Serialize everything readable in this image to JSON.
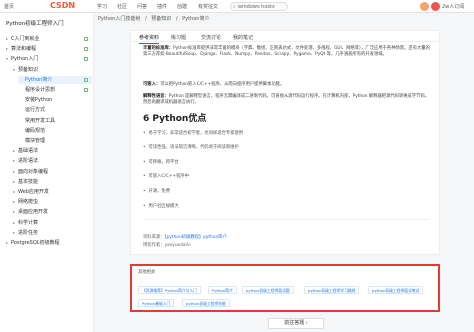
{
  "topbar": {
    "left_link": "首页",
    "logo": "CSDN",
    "nav": [
      "学习",
      "社区",
      "问答",
      "插件",
      "创建",
      "有奖征文"
    ],
    "search_text": "windows hosts",
    "user_label": "2w人订阅"
  },
  "sidebar": {
    "title": "Python初级工程师入门",
    "items": [
      {
        "label": "C入门到就业",
        "level": 0,
        "arrow": "▸",
        "editable": true
      },
      {
        "label": "算法和编程",
        "level": 0,
        "arrow": "▸",
        "editable": true
      },
      {
        "label": "Python入门",
        "level": 0,
        "arrow": "▾",
        "editable": true
      },
      {
        "label": "预备知识",
        "level": 1,
        "arrow": "▾",
        "editable": false
      },
      {
        "label": "Python简介",
        "level": 2,
        "arrow": "",
        "editable": true,
        "active": true
      },
      {
        "label": "程序设计思想",
        "level": 2,
        "arrow": "",
        "editable": true
      },
      {
        "label": "安装Python",
        "level": 2,
        "arrow": "",
        "editable": false
      },
      {
        "label": "运行方式",
        "level": 2,
        "arrow": "",
        "editable": false
      },
      {
        "label": "常用开发工具",
        "level": 2,
        "arrow": "",
        "editable": false
      },
      {
        "label": "编码规范",
        "level": 2,
        "arrow": "",
        "editable": false
      },
      {
        "label": "模块管理",
        "level": 2,
        "arrow": "",
        "editable": false
      },
      {
        "label": "基础语法",
        "level": 1,
        "arrow": "▸",
        "editable": false
      },
      {
        "label": "进阶语法",
        "level": 1,
        "arrow": "▸",
        "editable": false
      },
      {
        "label": "面向对象编程",
        "level": 1,
        "arrow": "▸",
        "editable": false
      },
      {
        "label": "基本技能",
        "level": 1,
        "arrow": "▸",
        "editable": false
      },
      {
        "label": "Web应用开发",
        "level": 1,
        "arrow": "▸",
        "editable": false
      },
      {
        "label": "网络爬虫",
        "level": 1,
        "arrow": "▸",
        "editable": false
      },
      {
        "label": "桌面应用开发",
        "level": 1,
        "arrow": "▸",
        "editable": false
      },
      {
        "label": "科学计算",
        "level": 1,
        "arrow": "▸",
        "editable": false
      },
      {
        "label": "进阶任务",
        "level": 1,
        "arrow": "▸",
        "editable": false
      },
      {
        "label": "PostgreSQL初级教程",
        "level": 0,
        "arrow": "▸",
        "editable": false
      }
    ]
  },
  "breadcrumb": [
    "Python入门技能树",
    "/",
    "预备知识",
    "/",
    "Python简介"
  ],
  "tabs": [
    "参考资料",
    "练习题",
    "交流讨论",
    "我的笔记"
  ],
  "content": {
    "p1_label": "丰富的标准库：",
    "p1_text": "Python标准库提供非常丰富的模块（字典、数组、正则表达式、文件处理、多线程、GUI、网络等），广泛应用于各种场景。还有大量的第三方库如 BeautifulSoup、Django、Flask、Numpy、Pandas、Scrapy、Pygame、PyQt 等，几乎涵盖所有的开发领域。",
    "p2_label": "可嵌入：",
    "p2_text": "可以把Python嵌入C/C++程序，从而向程序用户提供脚本功能。",
    "p3_label": "解释性语言：",
    "p3_text": "Python 是解释型语言，程序无需编译成二进制代码，可直接从源代码运行程序。在计算机内部，Python 解释器把源代码转换成字节码，然后再翻译成机器语言执行。",
    "section_title": "6 Python优点",
    "bullets": [
      "易于学习，非常适合初学者，也同样适合专家使用",
      "可读性强，语法简洁清晰，代码易于阅读和维护",
      "可移植，跨平台",
      "可嵌入C/C++程序中",
      "开源，免费",
      "用户社区规模大"
    ],
    "source_prefix": "资料来源：",
    "source_link": "【python初级教程】python简介",
    "author_prefix": "博客作者：",
    "author_name": "yaoyuedalin"
  },
  "related": {
    "title": "其他相关",
    "tags": [
      "【资源推荐】Python简介与入门",
      "Python简介",
      "python初级工程师面试题",
      "python初级工程师学习路线",
      "python初级工程师面试笔试",
      "Python基础入门",
      "python初级工程师技能"
    ]
  },
  "next_button": "前往答题 ›"
}
